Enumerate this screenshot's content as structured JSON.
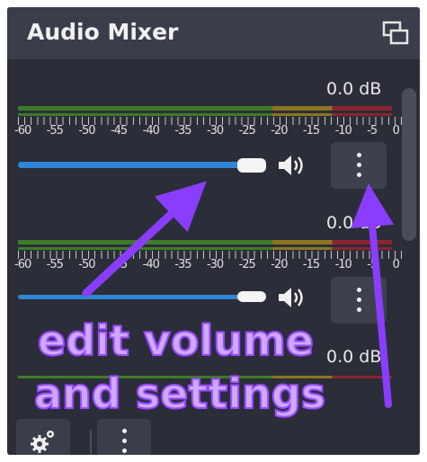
{
  "panel": {
    "title": "Audio Mixer",
    "undock_icon": "undock-icon"
  },
  "channels": [
    {
      "db_label": "0.0 dB",
      "meter_scale": [
        "-60",
        "-55",
        "-50",
        "-45",
        "-40",
        "-35",
        "-30",
        "-25",
        "-20",
        "-15",
        "-10",
        "-5",
        "0"
      ],
      "volume_fraction": 1.0,
      "menu_icon": "vertical-dots-icon",
      "mute_icon": "speaker-icon"
    },
    {
      "db_label": "0.0 dB",
      "meter_scale": [
        "-60",
        "-55",
        "-50",
        "-45",
        "-40",
        "-35",
        "-30",
        "-25",
        "-20",
        "-15",
        "-10",
        "-5",
        "0"
      ],
      "volume_fraction": 1.0,
      "menu_icon": "vertical-dots-icon",
      "mute_icon": "speaker-icon"
    },
    {
      "db_label": "0.0 dB"
    }
  ],
  "footer": {
    "settings_icon": "gear-icon",
    "menu_icon": "vertical-dots-icon"
  },
  "annotation": {
    "line1": "edit volume",
    "line2": "and settings",
    "color": "#b98cff"
  },
  "colors": {
    "panel_bg": "#2b2e38",
    "titlebar_bg": "#3a3e4b",
    "slider": "#2f85d6",
    "meter_green": "#3e7b29",
    "meter_yellow": "#8b7520",
    "meter_red": "#8a2430"
  }
}
